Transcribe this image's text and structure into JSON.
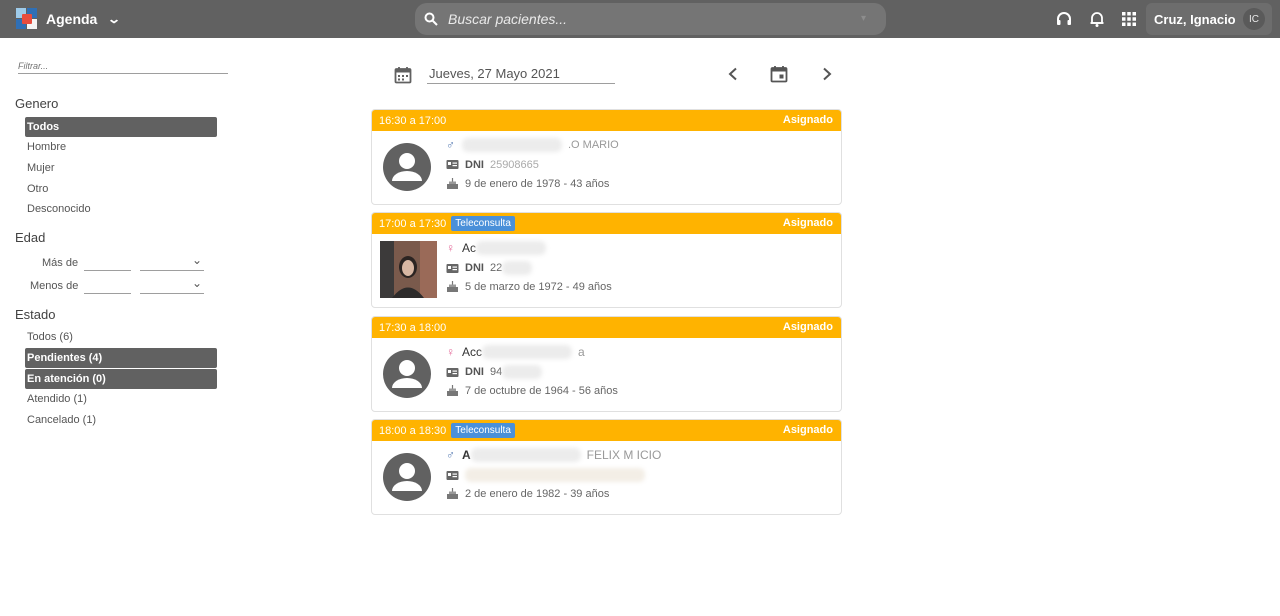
{
  "header": {
    "app_title": "Agenda",
    "search_placeholder": "Buscar pacientes...",
    "user_name": "Cruz, Ignacio",
    "user_initials": "IC"
  },
  "sidebar": {
    "filter_placeholder": "Filtrar...",
    "genero": {
      "title": "Genero",
      "options": [
        "Todos",
        "Hombre",
        "Mujer",
        "Otro",
        "Desconocido"
      ],
      "selected": "Todos"
    },
    "edad": {
      "title": "Edad",
      "mas_de": "Más de",
      "menos_de": "Menos de"
    },
    "estado": {
      "title": "Estado",
      "options": [
        "Todos (6)",
        "Pendientes (4)",
        "En atención (0)",
        "Atendido (1)",
        "Cancelado (1)"
      ]
    }
  },
  "main": {
    "date": "Jueves, 27 Mayo 2021",
    "appointments": [
      {
        "time": "16:30 a 17:00",
        "badge": "",
        "status": "Asignado",
        "name": "",
        "name_visible": "   .O MARIO",
        "sex": "male",
        "dni": "25908665",
        "dob": "9 de enero de 1978 - 43 años"
      },
      {
        "time": "17:00 a 17:30",
        "badge": "Teleconsulta",
        "status": "Asignado",
        "name": "Ac",
        "sex": "female",
        "dni": "22",
        "dob": "5 de marzo de 1972 - 49 años"
      },
      {
        "time": "17:30 a 18:00",
        "badge": "",
        "status": "Asignado",
        "name": "Acc",
        "name_tail": "a",
        "sex": "female",
        "dni": "94",
        "dob": "7 de octubre de 1964 - 56 años"
      },
      {
        "time": "18:00 a 18:30",
        "badge": "Teleconsulta",
        "status": "Asignado",
        "name": "A",
        "name_tail": "FELIX M   ICIO",
        "sex": "male",
        "dni": "",
        "dob": "2 de enero de 1982 - 39 años"
      }
    ]
  },
  "colors": {
    "topbar": "#616161",
    "accent_orange": "#ffb300",
    "tele_badge": "#4a90d9",
    "selected_bg": "#616161",
    "male": "#5b7fb5",
    "female": "#e46a9a"
  },
  "icons": [
    "agenda-logo-icon",
    "chevron-down-icon",
    "search-icon",
    "headset-icon",
    "bell-icon",
    "apps-grid-icon",
    "calendar-icon",
    "chevron-left-icon",
    "chevron-right-icon",
    "id-card-icon",
    "cake-icon",
    "male-icon",
    "female-icon",
    "avatar-placeholder-icon"
  ]
}
